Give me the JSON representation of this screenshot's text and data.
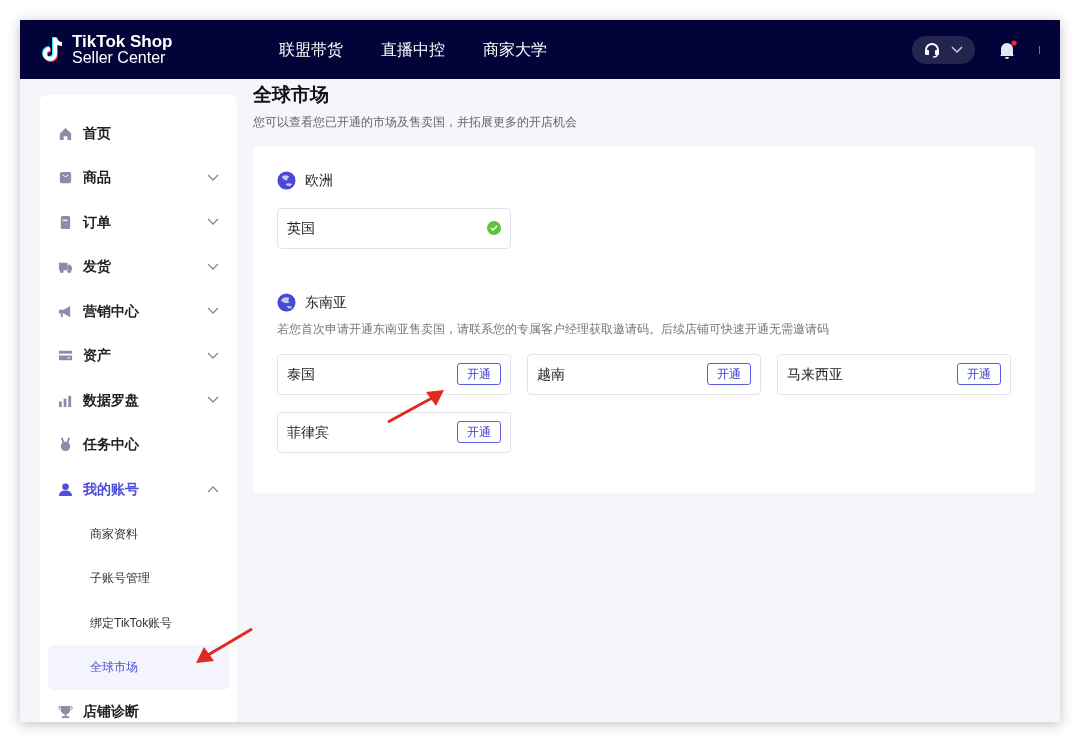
{
  "header": {
    "logo_title": "TikTok Shop",
    "logo_subtitle": "Seller Center",
    "nav": [
      {
        "label": "联盟带货"
      },
      {
        "label": "直播中控"
      },
      {
        "label": "商家大学"
      }
    ],
    "notifications_unread": true
  },
  "sidebar": {
    "items": [
      {
        "label": "首页",
        "selected": false
      },
      {
        "label": "商品",
        "selected": false,
        "expanded": false
      },
      {
        "label": "订单",
        "selected": false,
        "expanded": false
      },
      {
        "label": "发货",
        "selected": false,
        "expanded": false
      },
      {
        "label": "营销中心",
        "selected": false,
        "expanded": false
      },
      {
        "label": "资产",
        "selected": false,
        "expanded": false
      },
      {
        "label": "数据罗盘",
        "selected": false,
        "expanded": false
      },
      {
        "label": "任务中心",
        "selected": false
      },
      {
        "label": "我的账号",
        "selected": true,
        "expanded": true,
        "children": [
          {
            "label": "商家资料",
            "selected": false
          },
          {
            "label": "子账号管理",
            "selected": false
          },
          {
            "label": "绑定TikTok账号",
            "selected": false
          },
          {
            "label": "全球市场",
            "selected": true
          }
        ]
      },
      {
        "label": "店铺诊断",
        "selected": false
      }
    ]
  },
  "page": {
    "title": "全球市场",
    "subtitle": "您可以查看您已开通的市场及售卖国，并拓展更多的开店机会"
  },
  "regions": [
    {
      "name": "欧洲",
      "markets": [
        {
          "name": "英国",
          "opened": true
        }
      ]
    },
    {
      "name": "东南亚",
      "note": "若您首次申请开通东南亚售卖国，请联系您的专属客户经理获取邀请码。后续店铺可快速开通无需邀请码",
      "markets": [
        {
          "name": "泰国",
          "opened": false,
          "action": "开通"
        },
        {
          "name": "越南",
          "opened": false,
          "action": "开通"
        },
        {
          "name": "马来西亚",
          "opened": false,
          "action": "开通"
        },
        {
          "name": "菲律宾",
          "opened": false,
          "action": "开通"
        }
      ]
    }
  ]
}
